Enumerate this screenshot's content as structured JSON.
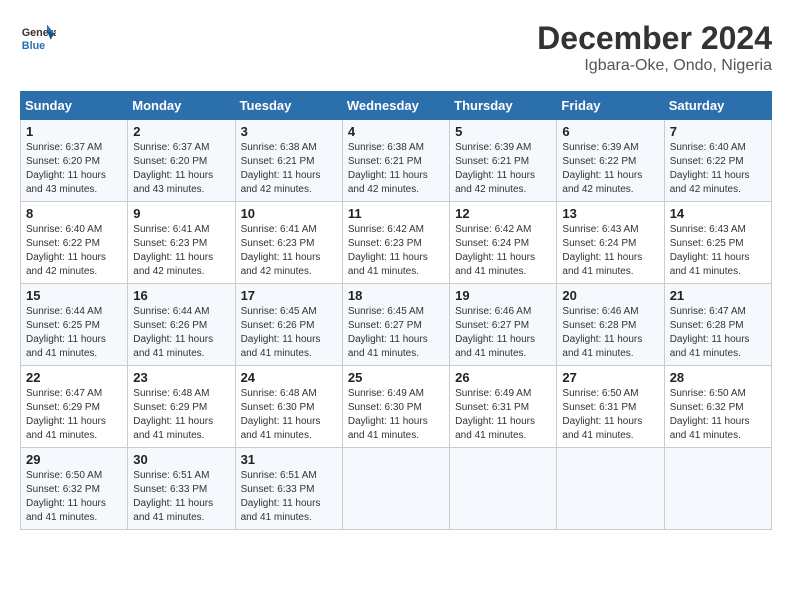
{
  "header": {
    "logo_line1": "General",
    "logo_line2": "Blue",
    "month_year": "December 2024",
    "location": "Igbara-Oke, Ondo, Nigeria"
  },
  "weekdays": [
    "Sunday",
    "Monday",
    "Tuesday",
    "Wednesday",
    "Thursday",
    "Friday",
    "Saturday"
  ],
  "weeks": [
    [
      {
        "day": "1",
        "info": "Sunrise: 6:37 AM\nSunset: 6:20 PM\nDaylight: 11 hours\nand 43 minutes."
      },
      {
        "day": "2",
        "info": "Sunrise: 6:37 AM\nSunset: 6:20 PM\nDaylight: 11 hours\nand 43 minutes."
      },
      {
        "day": "3",
        "info": "Sunrise: 6:38 AM\nSunset: 6:21 PM\nDaylight: 11 hours\nand 42 minutes."
      },
      {
        "day": "4",
        "info": "Sunrise: 6:38 AM\nSunset: 6:21 PM\nDaylight: 11 hours\nand 42 minutes."
      },
      {
        "day": "5",
        "info": "Sunrise: 6:39 AM\nSunset: 6:21 PM\nDaylight: 11 hours\nand 42 minutes."
      },
      {
        "day": "6",
        "info": "Sunrise: 6:39 AM\nSunset: 6:22 PM\nDaylight: 11 hours\nand 42 minutes."
      },
      {
        "day": "7",
        "info": "Sunrise: 6:40 AM\nSunset: 6:22 PM\nDaylight: 11 hours\nand 42 minutes."
      }
    ],
    [
      {
        "day": "8",
        "info": "Sunrise: 6:40 AM\nSunset: 6:22 PM\nDaylight: 11 hours\nand 42 minutes."
      },
      {
        "day": "9",
        "info": "Sunrise: 6:41 AM\nSunset: 6:23 PM\nDaylight: 11 hours\nand 42 minutes."
      },
      {
        "day": "10",
        "info": "Sunrise: 6:41 AM\nSunset: 6:23 PM\nDaylight: 11 hours\nand 42 minutes."
      },
      {
        "day": "11",
        "info": "Sunrise: 6:42 AM\nSunset: 6:23 PM\nDaylight: 11 hours\nand 41 minutes."
      },
      {
        "day": "12",
        "info": "Sunrise: 6:42 AM\nSunset: 6:24 PM\nDaylight: 11 hours\nand 41 minutes."
      },
      {
        "day": "13",
        "info": "Sunrise: 6:43 AM\nSunset: 6:24 PM\nDaylight: 11 hours\nand 41 minutes."
      },
      {
        "day": "14",
        "info": "Sunrise: 6:43 AM\nSunset: 6:25 PM\nDaylight: 11 hours\nand 41 minutes."
      }
    ],
    [
      {
        "day": "15",
        "info": "Sunrise: 6:44 AM\nSunset: 6:25 PM\nDaylight: 11 hours\nand 41 minutes."
      },
      {
        "day": "16",
        "info": "Sunrise: 6:44 AM\nSunset: 6:26 PM\nDaylight: 11 hours\nand 41 minutes."
      },
      {
        "day": "17",
        "info": "Sunrise: 6:45 AM\nSunset: 6:26 PM\nDaylight: 11 hours\nand 41 minutes."
      },
      {
        "day": "18",
        "info": "Sunrise: 6:45 AM\nSunset: 6:27 PM\nDaylight: 11 hours\nand 41 minutes."
      },
      {
        "day": "19",
        "info": "Sunrise: 6:46 AM\nSunset: 6:27 PM\nDaylight: 11 hours\nand 41 minutes."
      },
      {
        "day": "20",
        "info": "Sunrise: 6:46 AM\nSunset: 6:28 PM\nDaylight: 11 hours\nand 41 minutes."
      },
      {
        "day": "21",
        "info": "Sunrise: 6:47 AM\nSunset: 6:28 PM\nDaylight: 11 hours\nand 41 minutes."
      }
    ],
    [
      {
        "day": "22",
        "info": "Sunrise: 6:47 AM\nSunset: 6:29 PM\nDaylight: 11 hours\nand 41 minutes."
      },
      {
        "day": "23",
        "info": "Sunrise: 6:48 AM\nSunset: 6:29 PM\nDaylight: 11 hours\nand 41 minutes."
      },
      {
        "day": "24",
        "info": "Sunrise: 6:48 AM\nSunset: 6:30 PM\nDaylight: 11 hours\nand 41 minutes."
      },
      {
        "day": "25",
        "info": "Sunrise: 6:49 AM\nSunset: 6:30 PM\nDaylight: 11 hours\nand 41 minutes."
      },
      {
        "day": "26",
        "info": "Sunrise: 6:49 AM\nSunset: 6:31 PM\nDaylight: 11 hours\nand 41 minutes."
      },
      {
        "day": "27",
        "info": "Sunrise: 6:50 AM\nSunset: 6:31 PM\nDaylight: 11 hours\nand 41 minutes."
      },
      {
        "day": "28",
        "info": "Sunrise: 6:50 AM\nSunset: 6:32 PM\nDaylight: 11 hours\nand 41 minutes."
      }
    ],
    [
      {
        "day": "29",
        "info": "Sunrise: 6:50 AM\nSunset: 6:32 PM\nDaylight: 11 hours\nand 41 minutes."
      },
      {
        "day": "30",
        "info": "Sunrise: 6:51 AM\nSunset: 6:33 PM\nDaylight: 11 hours\nand 41 minutes."
      },
      {
        "day": "31",
        "info": "Sunrise: 6:51 AM\nSunset: 6:33 PM\nDaylight: 11 hours\nand 41 minutes."
      },
      null,
      null,
      null,
      null
    ]
  ]
}
